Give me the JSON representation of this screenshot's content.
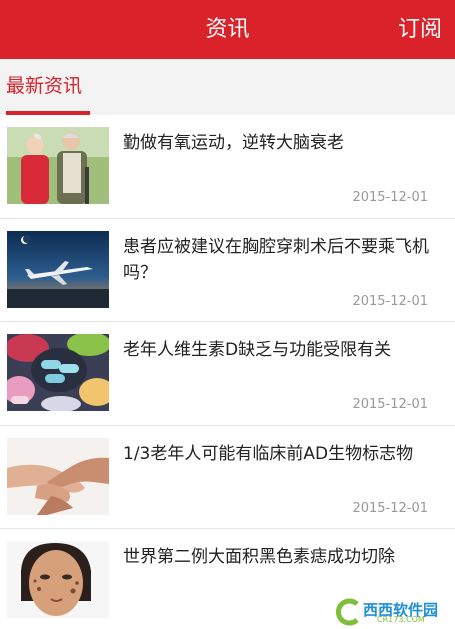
{
  "header": {
    "title": "资讯",
    "subscribe_label": "订阅"
  },
  "tabs": [
    {
      "label": "最新资讯",
      "active": true
    }
  ],
  "articles": [
    {
      "title": "勤做有氧运动，逆转大脑衰老",
      "date": "2015-12-01",
      "thumb": "elderly-couple"
    },
    {
      "title": "患者应被建议在胸腔穿刺术后不要乘飞机吗？",
      "date": "2015-12-01",
      "thumb": "airplane"
    },
    {
      "title": "老年人维生素D缺乏与功能受限有关",
      "date": "2015-12-01",
      "thumb": "pills"
    },
    {
      "title": "1/3老年人可能有临床前AD生物标志物",
      "date": "2015-12-01",
      "thumb": "holding-hands"
    },
    {
      "title": "世界第二例大面积黑色素痣成功切除",
      "date": "",
      "thumb": "face-portrait"
    }
  ],
  "watermark": {
    "text": "西西软件园",
    "sub": "CR173.COM"
  },
  "colors": {
    "brand_red": "#d9222a",
    "tab_bg": "#f3f3f3",
    "date_gray": "#999999"
  }
}
